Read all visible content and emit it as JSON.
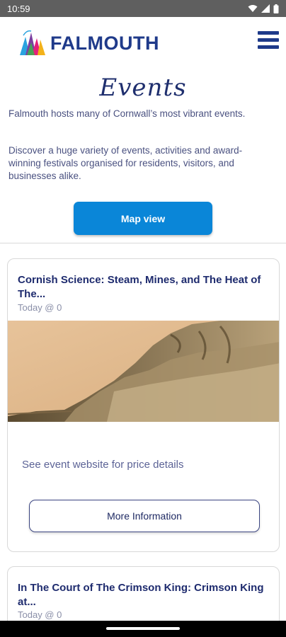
{
  "status_bar": {
    "time": "10:59",
    "icons": [
      "wifi-icon",
      "signal-icon",
      "battery-icon"
    ]
  },
  "header": {
    "brand": "FALMOUTH",
    "menu_icon": "hamburger-menu-icon"
  },
  "page": {
    "title": "Events",
    "intro": "Falmouth hosts many of Cornwall’s most vibrant events.",
    "intro_2": "Discover a huge variety of events, activities and award-winning festivals organised for residents, visitors, and businesses alike.",
    "map_button": "Map view"
  },
  "events": [
    {
      "title": "Cornish Science: Steam, Mines, and The Heat of The...",
      "date": "Today @ 0",
      "price": "See event website for price details",
      "more_button": "More Information"
    },
    {
      "title": "In The Court of The Crimson King: Crimson King at...",
      "date": "Today @ 0"
    }
  ],
  "colors": {
    "brand": "#1f3a8a",
    "primary_button": "#0a86d8",
    "text": "#1f2a63"
  }
}
